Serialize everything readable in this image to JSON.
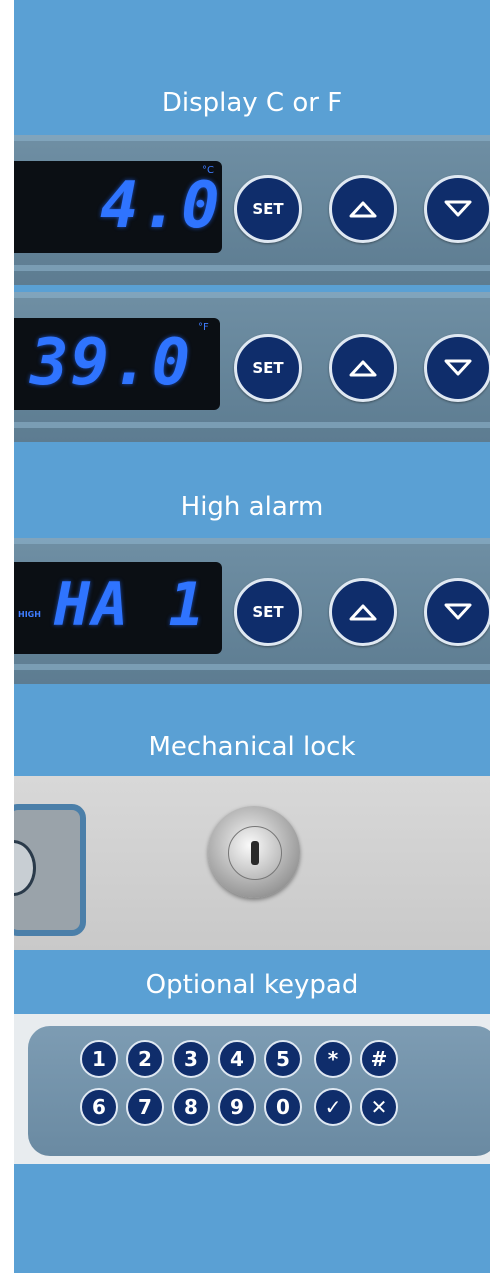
{
  "captions": {
    "display": "Display C or F",
    "high_alarm": "High alarm",
    "lock": "Mechanical lock",
    "keypad": "Optional keypad"
  },
  "panels": [
    {
      "reading": "4.0",
      "unit": "°C",
      "set_label": "SET"
    },
    {
      "reading": "39.0",
      "unit": "°F",
      "set_label": "SET"
    },
    {
      "reading": "HA 1",
      "tag": "HIGH",
      "set_label": "SET"
    }
  ],
  "keypad": {
    "row1": [
      "1",
      "2",
      "3",
      "4",
      "5",
      "*",
      "#"
    ],
    "row2": [
      "6",
      "7",
      "8",
      "9",
      "0",
      "✓",
      "✕"
    ]
  },
  "icons": [
    "up-arrow-icon",
    "down-arrow-icon",
    "key-lock-icon"
  ],
  "colors": {
    "background": "#5aa0d4",
    "button": "#0f2d6b",
    "lcd_digits": "#2f74ff"
  }
}
